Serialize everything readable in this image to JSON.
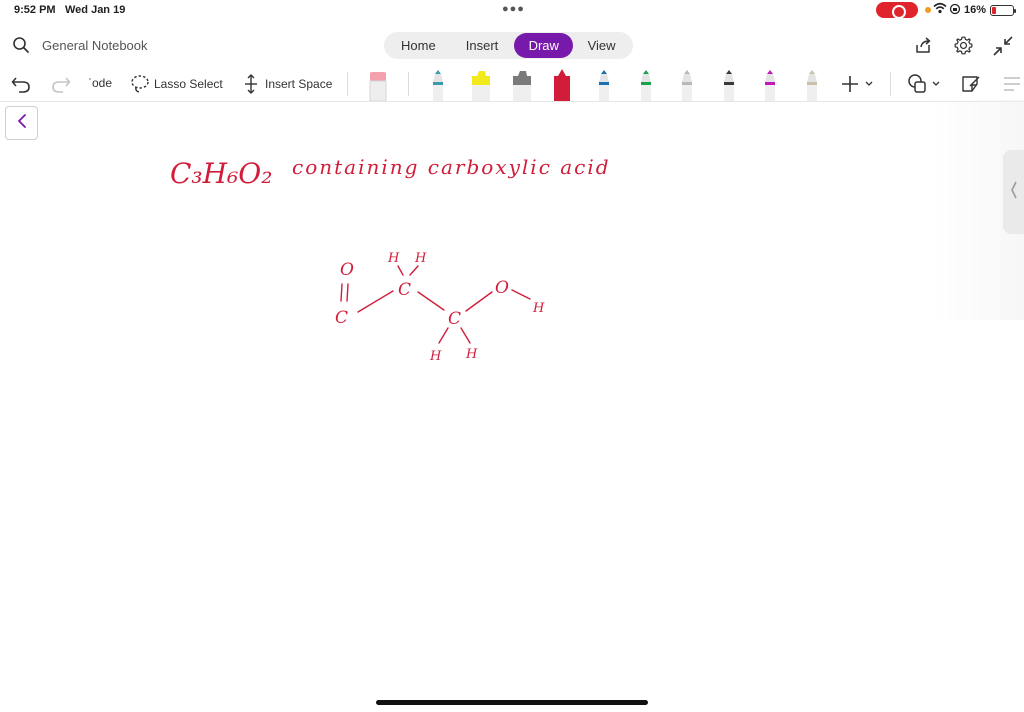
{
  "status_bar": {
    "time": "9:52 PM",
    "date": "Wed Jan 19",
    "battery": "16%"
  },
  "top_bar": {
    "notebook_name": "General Notebook",
    "tabs": [
      {
        "label": "Home"
      },
      {
        "label": "Insert"
      },
      {
        "label": "Draw"
      },
      {
        "label": "View"
      }
    ],
    "active_tab": "Draw"
  },
  "toolbar": {
    "mode_label": "ˈode",
    "lasso_label": "Lasso Select",
    "insert_space_label": "Insert Space",
    "pens": [
      {
        "name": "eraser",
        "color": "#f3a0ad"
      },
      {
        "name": "pen-teal",
        "color": "#3a9bab"
      },
      {
        "name": "highlighter-yellow",
        "color": "#f2ea1c"
      },
      {
        "name": "highlighter-gray",
        "color": "#7a7a7a"
      },
      {
        "name": "pen-red",
        "color": "#d11d3a"
      },
      {
        "name": "pen-blue",
        "color": "#1a6fb0"
      },
      {
        "name": "pen-green",
        "color": "#1aa24a"
      },
      {
        "name": "pen-lightgray",
        "color": "#b8b8b8"
      },
      {
        "name": "pen-black",
        "color": "#3a3a3a"
      },
      {
        "name": "pen-magenta",
        "color": "#c21ab8"
      },
      {
        "name": "pen-tan",
        "color": "#c9c2aa"
      }
    ]
  },
  "canvas": {
    "ink_color": "#d11d3a",
    "handwriting": {
      "formula": "C₃H₆O₂",
      "line1": "containing carboxylic acid"
    },
    "structure_labels": {
      "o_double": "O",
      "c1": "C",
      "h_top1": "H",
      "h_top2": "H",
      "c2": "C",
      "c3": "C",
      "o_hydroxyl": "O",
      "h_hydroxyl": "H",
      "h_bottom1": "H",
      "h_bottom2": "H"
    }
  },
  "colors": {
    "accent": "#7719aa",
    "recording": "#e0242c"
  }
}
